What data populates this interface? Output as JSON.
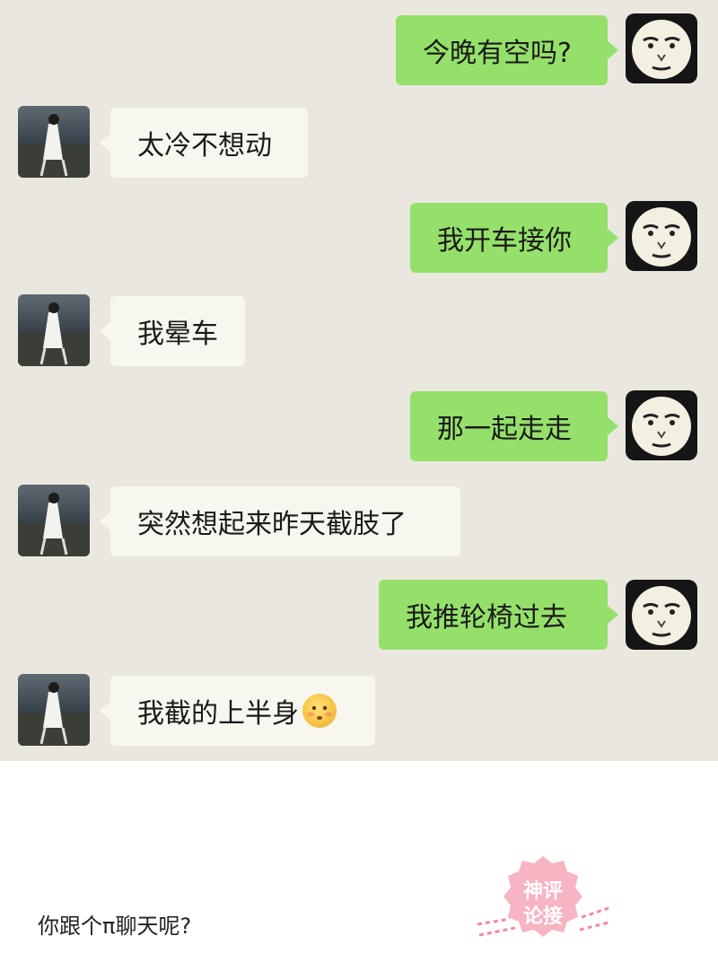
{
  "chat": {
    "messages": [
      {
        "side": "right",
        "text": "今晚有空吗?"
      },
      {
        "side": "left",
        "text": "太冷不想动"
      },
      {
        "side": "right",
        "text": "我开车接你"
      },
      {
        "side": "left",
        "text": "我晕车"
      },
      {
        "side": "right",
        "text": "那一起走走"
      },
      {
        "side": "left",
        "text": "突然想起来昨天截肢了"
      },
      {
        "side": "right",
        "text": "我推轮椅过去"
      },
      {
        "side": "left",
        "text": "我截的上半身",
        "emoji": "flushed-face-emoji"
      }
    ]
  },
  "comment": {
    "text": "你跟个π聊天呢?"
  },
  "watermark": {
    "line1": "神评",
    "line2": "论接"
  },
  "colors": {
    "chat_background": "#eae8de",
    "sent_bubble": "#95e06b",
    "received_bubble": "#f7f6ef",
    "stamp_pink": "#f06c8a"
  },
  "icons": {
    "sender_avatar": "meme-face-avatar-icon",
    "receiver_avatar": "girl-photo-avatar-icon"
  }
}
